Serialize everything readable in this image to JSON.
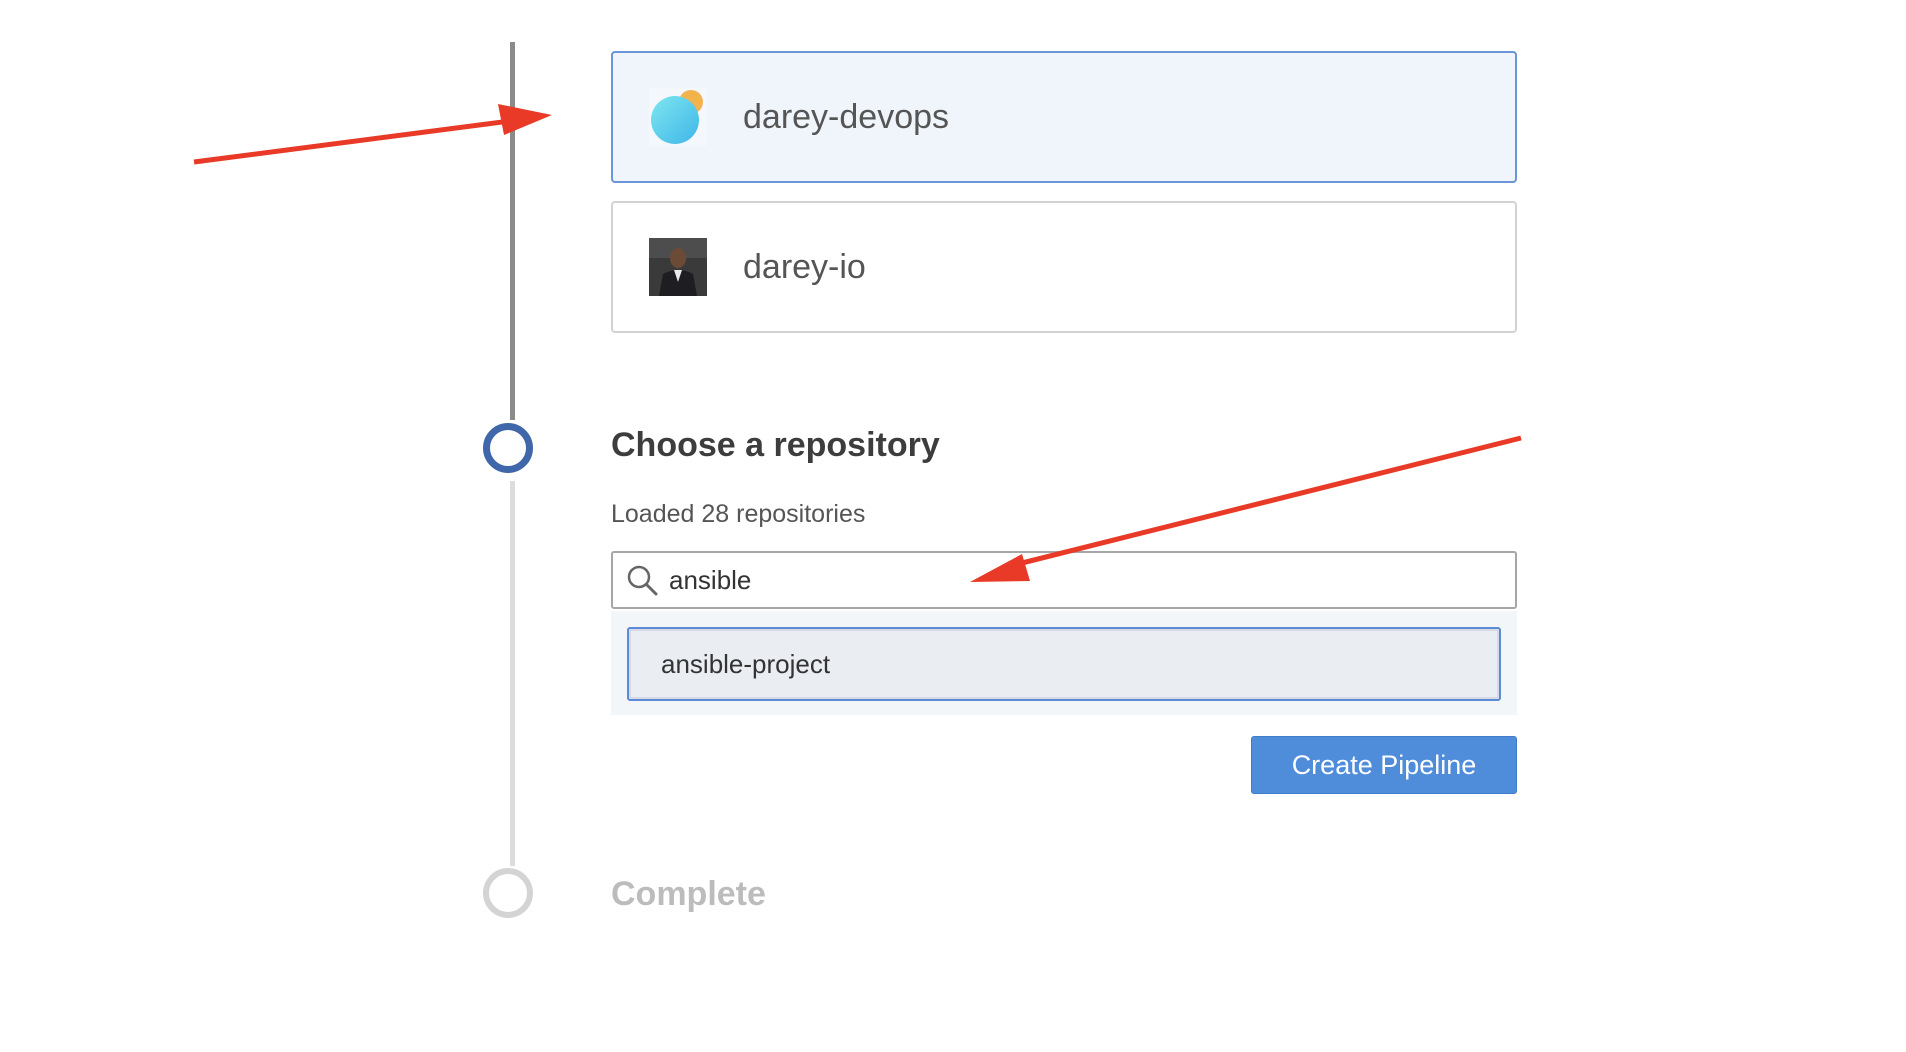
{
  "organizations": [
    {
      "name": "darey-devops",
      "avatar_icon": "darey-devops-logo-icon",
      "selected": true
    },
    {
      "name": "darey-io",
      "avatar_icon": "person-photo-icon",
      "selected": false
    }
  ],
  "repository_step": {
    "title": "Choose a repository",
    "status": "Loaded 28 repositories",
    "search": {
      "value": "ansible",
      "icon": "search-icon"
    },
    "results": [
      {
        "label": "ansible-project"
      }
    ],
    "create_button_label": "Create Pipeline"
  },
  "complete_step": {
    "title": "Complete"
  },
  "colors": {
    "accent": "#4f8ddb",
    "step_active": "#3f67a9",
    "annotation_arrow": "#e83a26"
  }
}
